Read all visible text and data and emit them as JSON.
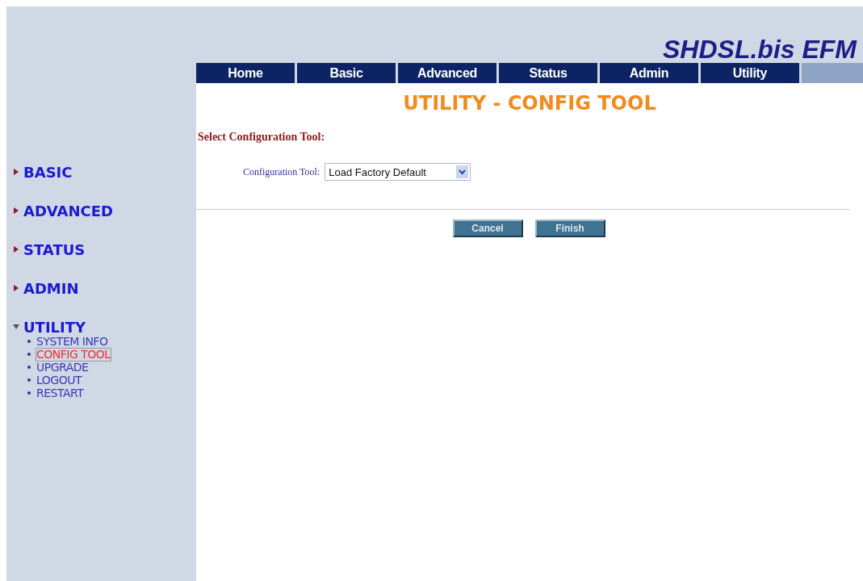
{
  "header": {
    "title": "SHDSL.bis EFM"
  },
  "nav": [
    {
      "label": "Home"
    },
    {
      "label": "Basic"
    },
    {
      "label": "Advanced"
    },
    {
      "label": "Status"
    },
    {
      "label": "Admin"
    },
    {
      "label": "Utility"
    }
  ],
  "sidebar": {
    "sections": [
      {
        "label": "BASIC",
        "expanded": false
      },
      {
        "label": "ADVANCED",
        "expanded": false
      },
      {
        "label": "STATUS",
        "expanded": false
      },
      {
        "label": "ADMIN",
        "expanded": false
      },
      {
        "label": "UTILITY",
        "expanded": true,
        "children": [
          {
            "label": "SYSTEM INFO",
            "selected": false
          },
          {
            "label": "CONFIG TOOL",
            "selected": true
          },
          {
            "label": "UPGRADE",
            "selected": false
          },
          {
            "label": "LOGOUT",
            "selected": false
          },
          {
            "label": "RESTART",
            "selected": false
          }
        ]
      }
    ]
  },
  "page_title": "UTILITY - CONFIG TOOL",
  "section_heading": "Select Configuration Tool:",
  "field": {
    "label": "Configuration Tool:",
    "value": "Load Factory Default"
  },
  "buttons": [
    "Cancel",
    "Finish"
  ]
}
